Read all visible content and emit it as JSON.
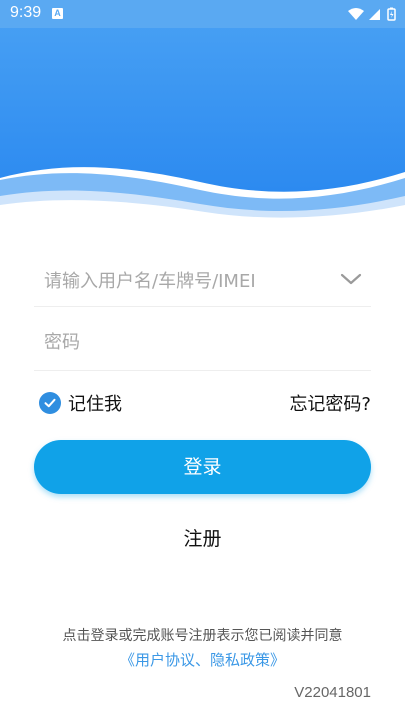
{
  "status_bar": {
    "time": "9:39",
    "notification_badge": "A",
    "icons": [
      "wifi-icon",
      "signal-icon",
      "battery-icon"
    ]
  },
  "colors": {
    "header_top": "#4aa2f4",
    "header_bottom": "#2c8af0",
    "accent": "#10a2e8",
    "link": "#3b98e6"
  },
  "form": {
    "username_placeholder": "请输入用户名/车牌号/IMEI",
    "username_value": "",
    "password_placeholder": "密码",
    "password_value": "",
    "remember_label": "记住我",
    "remember_checked": true,
    "forgot_label": "忘记密码?",
    "login_label": "登录",
    "register_label": "注册"
  },
  "footer": {
    "agreement_text": "点击登录或完成账号注册表示您已阅读并同意",
    "agreement_link": "《用户协议、隐私政策》",
    "version": "V22041801"
  }
}
